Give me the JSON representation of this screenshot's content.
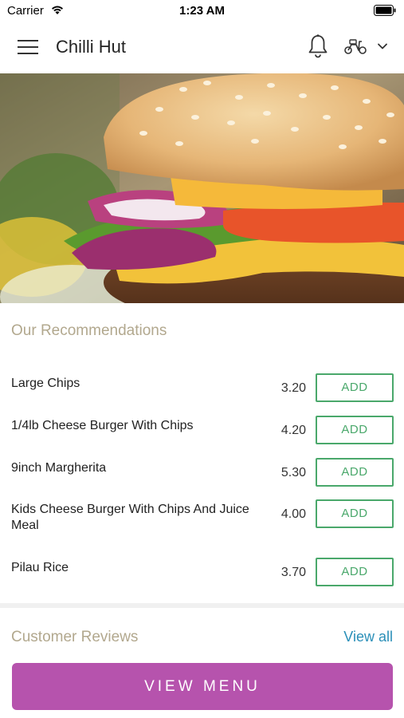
{
  "status": {
    "carrier": "Carrier",
    "time": "1:23 AM"
  },
  "header": {
    "title": "Chilli Hut",
    "icons": [
      "menu-icon",
      "bell-icon",
      "scooter-icon",
      "chevron-down-icon"
    ]
  },
  "hero": {
    "image": "burger-photo"
  },
  "recommendations": {
    "title": "Our Recommendations",
    "items": [
      {
        "name": "Large Chips",
        "price": "3.20",
        "action": "ADD"
      },
      {
        "name": "1/4lb Cheese Burger With Chips",
        "price": "4.20",
        "action": "ADD"
      },
      {
        "name": "9inch Margherita",
        "price": "5.30",
        "action": "ADD"
      },
      {
        "name": "Kids Cheese Burger With Chips And Juice Meal",
        "price": "4.00",
        "action": "ADD"
      },
      {
        "name": "Pilau Rice",
        "price": "3.70",
        "action": "ADD"
      }
    ]
  },
  "reviews": {
    "title": "Customer Reviews",
    "view_all": "View all"
  },
  "footer": {
    "view_menu": "VIEW MENU"
  },
  "colors": {
    "accent": "#b653ad",
    "add_green": "#4aa86b",
    "section_title": "#b2a88e",
    "link": "#2a8fb8"
  }
}
